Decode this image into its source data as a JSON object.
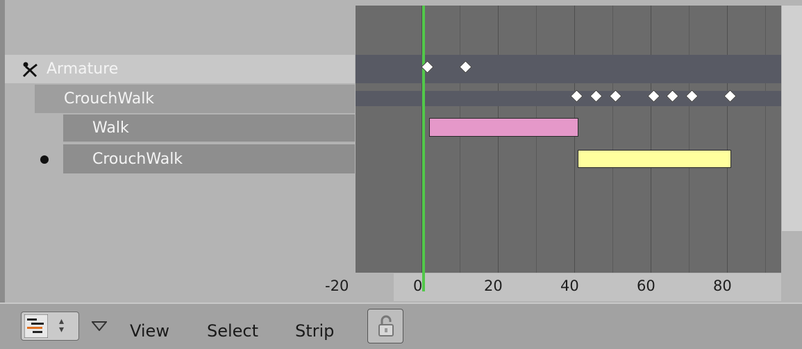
{
  "channels": {
    "object": "Armature",
    "action": "CrouchWalk",
    "strips": [
      "Walk",
      "CrouchWalk"
    ]
  },
  "ruler": {
    "labels": [
      "-20",
      "0",
      "20",
      "40",
      "60",
      "80"
    ]
  },
  "header": {
    "menus": [
      "View",
      "Select",
      "Strip"
    ]
  },
  "icons": {
    "editor_type": "nla-editor-icon",
    "armature": "armature-icon",
    "lock": "lock-icon",
    "collapse": "triangle-down-icon"
  },
  "colors": {
    "walk_strip": "#e598c9",
    "crouchwalk_strip": "#ffff9e",
    "playhead": "#52c84a",
    "keyframe": "#ffffff",
    "selected_channel": "#c8c8c8"
  },
  "strips_data": [
    {
      "name": "Walk",
      "start": 2,
      "end": 41
    },
    {
      "name": "CrouchWalk",
      "start": 41,
      "end": 81
    }
  ],
  "keyframes": {
    "armature": [
      1,
      12
    ],
    "crouchwalk": [
      42,
      47,
      52,
      62,
      67,
      72,
      82
    ]
  },
  "current_frame": 1
}
